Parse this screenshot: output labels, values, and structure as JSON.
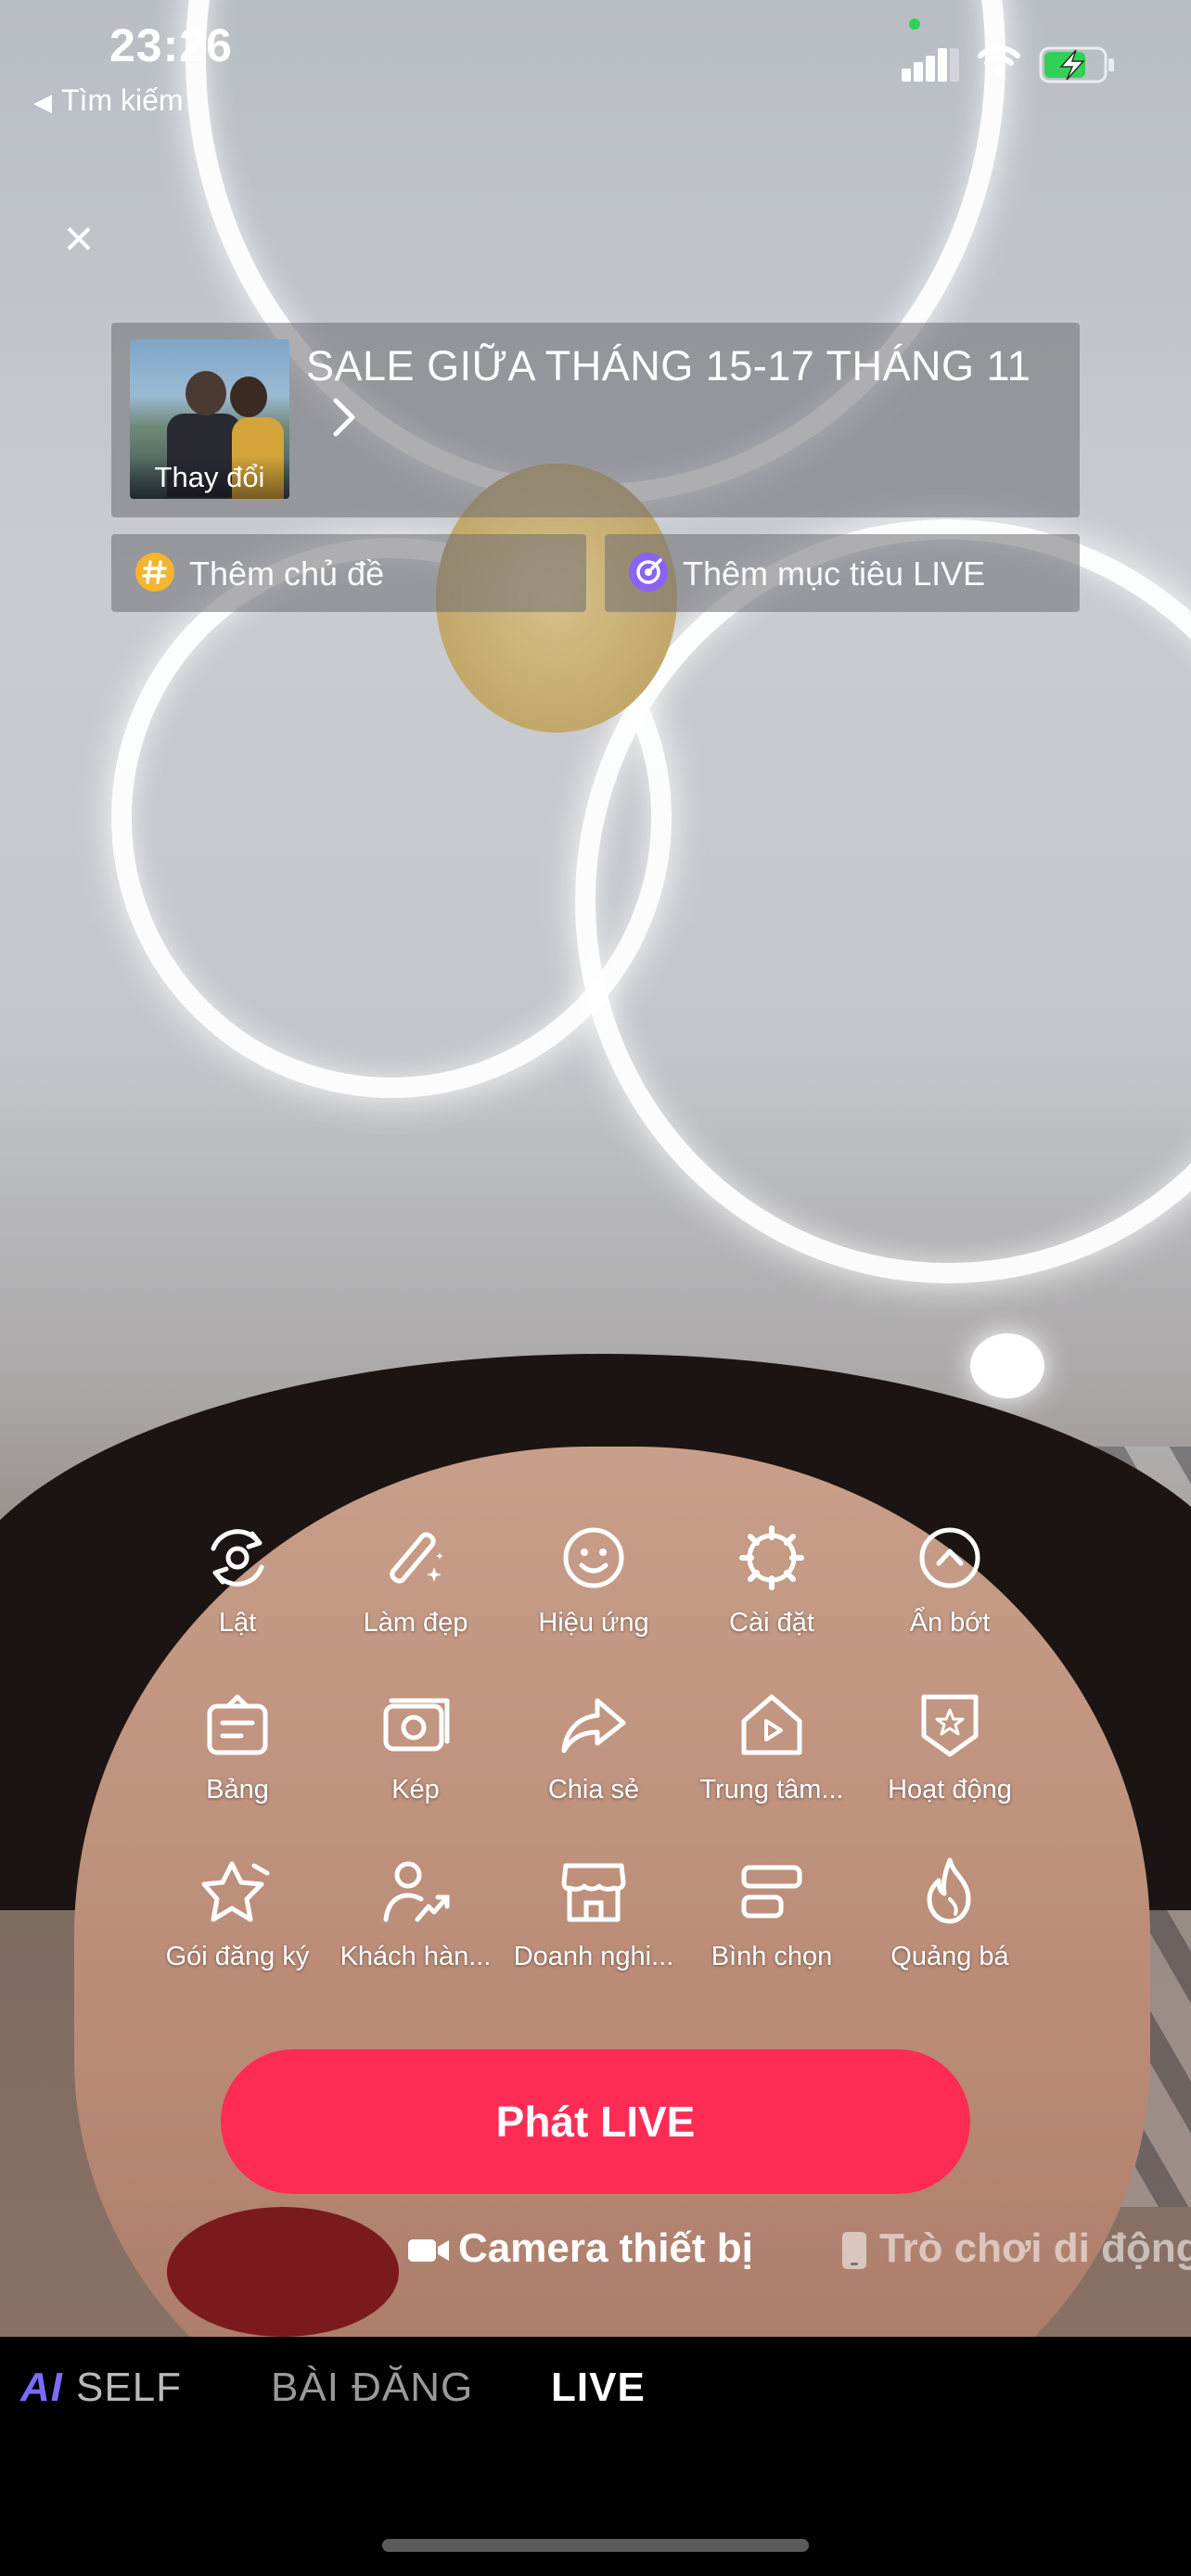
{
  "status_bar": {
    "time": "23:26",
    "back_label": "Tìm kiếm"
  },
  "header": {
    "title": "SALE GIỮA THÁNG 15-17 THÁNG 11",
    "thumbnail_label": "Thay đổi",
    "chips": [
      {
        "label": "Thêm chủ đề",
        "icon": "hashtag-icon",
        "color": "#f5b52d"
      },
      {
        "label": "Thêm mục tiêu LIVE",
        "icon": "target-icon",
        "color": "#8a63f5"
      }
    ]
  },
  "tools": [
    {
      "label": "Lật",
      "icon": "flip-camera-icon"
    },
    {
      "label": "Làm đẹp",
      "icon": "beauty-wand-icon"
    },
    {
      "label": "Hiệu ứng",
      "icon": "smile-effects-icon"
    },
    {
      "label": "Cài đặt",
      "icon": "settings-gear-icon"
    },
    {
      "label": "Ẩn bớt",
      "icon": "collapse-up-icon"
    },
    {
      "label": "Bảng",
      "icon": "board-icon"
    },
    {
      "label": "Kép",
      "icon": "dual-camera-icon"
    },
    {
      "label": "Chia sẻ",
      "icon": "share-arrow-icon"
    },
    {
      "label": "Trung tâm...",
      "icon": "play-house-icon"
    },
    {
      "label": "Hoạt động",
      "icon": "activity-badge-icon"
    },
    {
      "label": "Gói đăng ký",
      "icon": "subscription-star-icon"
    },
    {
      "label": "Khách hàn...",
      "icon": "customer-trend-icon"
    },
    {
      "label": "Doanh nghi...",
      "icon": "business-store-icon"
    },
    {
      "label": "Bình chọn",
      "icon": "poll-icon"
    },
    {
      "label": "Quảng bá",
      "icon": "promote-flame-icon"
    }
  ],
  "primary_action": {
    "label": "Phát LIVE",
    "color": "#fe2c55"
  },
  "modes": [
    {
      "label": "Camera thiết bị",
      "icon": "video-camera-icon"
    },
    {
      "label": "Trò chơi di động",
      "icon": "phone-icon"
    }
  ],
  "bottom_tabs": [
    {
      "badge": "AI",
      "label": "SELF"
    },
    {
      "label": "BÀI ĐĂNG"
    },
    {
      "label": "LIVE"
    }
  ]
}
